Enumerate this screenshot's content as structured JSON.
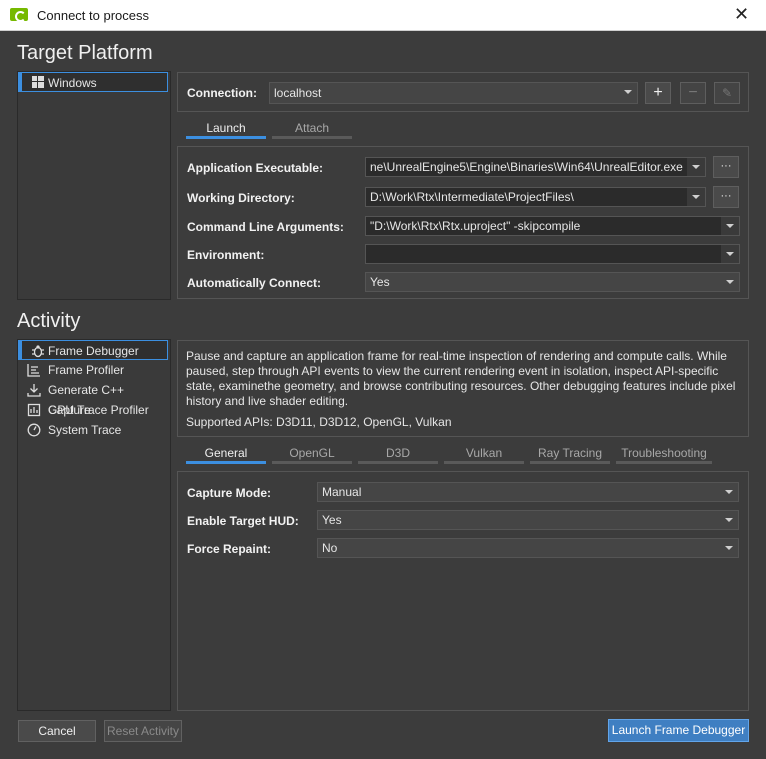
{
  "window": {
    "title": "Connect to process"
  },
  "target_platform": {
    "section_title": "Target Platform",
    "platforms": [
      {
        "label": "Windows"
      }
    ],
    "connection": {
      "label": "Connection:",
      "value": "localhost"
    },
    "tabs": [
      {
        "label": "Launch"
      },
      {
        "label": "Attach"
      }
    ],
    "fields": {
      "app_exe": {
        "label": "Application Executable:",
        "value": "ne\\UnrealEngine5\\Engine\\Binaries\\Win64\\UnrealEditor.exe"
      },
      "working_dir": {
        "label": "Working Directory:",
        "value": "D:\\Work\\Rtx\\Intermediate\\ProjectFiles\\"
      },
      "cmd_args": {
        "label": "Command Line Arguments:",
        "value": "\"D:\\Work\\Rtx\\Rtx.uproject\" -skipcompile"
      },
      "environment": {
        "label": "Environment:",
        "value": ""
      },
      "auto_connect": {
        "label": "Automatically Connect:",
        "value": "Yes"
      }
    },
    "browse_label": "···"
  },
  "activity": {
    "section_title": "Activity",
    "items": [
      {
        "label": "Frame Debugger",
        "icon": "bug-icon"
      },
      {
        "label": "Frame Profiler",
        "icon": "bar-chart-icon"
      },
      {
        "label": "Generate C++ Capture",
        "icon": "download-icon"
      },
      {
        "label": "GPU Trace Profiler",
        "icon": "gpu-trace-icon"
      },
      {
        "label": "System Trace",
        "icon": "clock-icon"
      }
    ],
    "description": "Pause and capture an application frame for real-time inspection of rendering and compute calls. While paused, step through API events to view the current rendering event in isolation, inspect API-specific state, examinethe geometry, and browse contributing resources. Other debugging features include pixel history and live shader editing.",
    "supported_apis": "Supported APIs: D3D11, D3D12, OpenGL, Vulkan",
    "tabs": [
      {
        "label": "General"
      },
      {
        "label": "OpenGL"
      },
      {
        "label": "D3D"
      },
      {
        "label": "Vulkan"
      },
      {
        "label": "Ray Tracing"
      },
      {
        "label": "Troubleshooting"
      }
    ],
    "settings": {
      "capture_mode": {
        "label": "Capture Mode:",
        "value": "Manual"
      },
      "target_hud": {
        "label": "Enable Target HUD:",
        "value": "Yes"
      },
      "force_repaint": {
        "label": "Force Repaint:",
        "value": "No"
      }
    }
  },
  "footer": {
    "cancel": "Cancel",
    "reset": "Reset Activity",
    "launch": "Launch Frame Debugger"
  },
  "colors": {
    "accent": "#3c8fe0",
    "nvidia_green": "#76b900",
    "background": "#3c3c3c"
  }
}
